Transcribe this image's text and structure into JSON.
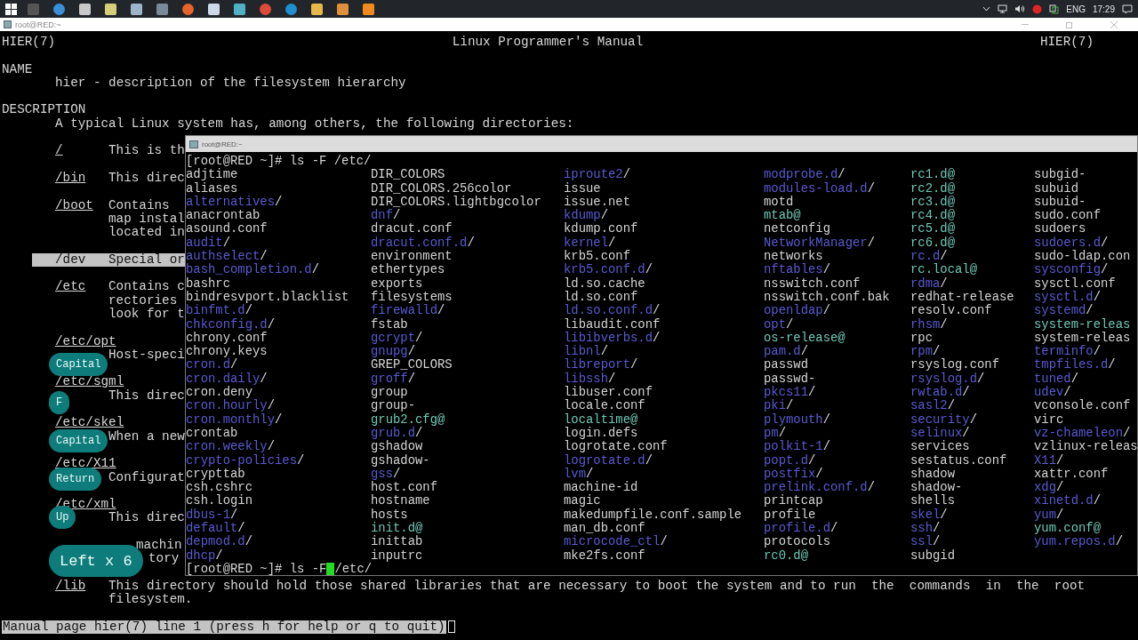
{
  "taskbar": {
    "tray": {
      "language": "ENG",
      "time": "17:29"
    }
  },
  "window": {
    "title": "root@RED:~"
  },
  "man_page": {
    "header_left": "HIER(7)",
    "header_center": "Linux Programmer's Manual",
    "header_right": "HIER(7)",
    "sections": [
      {
        "heading": "NAME",
        "paragraphs": [
          "hier - description of the filesystem hierarchy"
        ]
      },
      {
        "heading": "DESCRIPTION",
        "paragraphs": [
          "A typical Linux system has, among others, the following directories:"
        ],
        "entries": [
          {
            "kind": "inline",
            "tag": "/",
            "lines": [
              "This is th"
            ],
            "highlighted": false
          },
          {
            "kind": "inline",
            "tag": "/bin",
            "lines": [
              "This direc"
            ],
            "highlighted": false
          },
          {
            "kind": "inline",
            "tag": "/boot",
            "lines": [
              "Contains",
              "map instal",
              "located in"
            ],
            "highlighted": false
          },
          {
            "kind": "inline",
            "tag": "/dev",
            "lines": [
              "Special or"
            ],
            "highlighted": true
          },
          {
            "kind": "inline",
            "tag": "/etc",
            "lines": [
              "Contains c",
              "rectories",
              "look for t"
            ],
            "highlighted": false
          },
          {
            "kind": "hanging",
            "tag": "/etc/opt",
            "lines": [
              "Host-speci"
            ],
            "highlighted": false
          },
          {
            "kind": "hanging",
            "tag": "/etc/sgml",
            "lines": [
              "This direc"
            ],
            "highlighted": false
          },
          {
            "kind": "hanging",
            "tag": "/etc/skel",
            "lines": [
              "When a new"
            ],
            "highlighted": false
          },
          {
            "kind": "hanging",
            "tag": "/etc/X11",
            "lines": [
              "Configurat"
            ],
            "highlighted": false
          },
          {
            "kind": "hanging",
            "tag": "/etc/xml",
            "lines": [
              "This direc"
            ],
            "highlighted": false
          },
          {
            "kind": "covered",
            "lines": [
              "machin",
              "tory"
            ],
            "highlighted": false
          },
          {
            "kind": "inline",
            "tag": "/lib",
            "lines": [
              "This directory should hold those shared libraries that are necessary to boot the system and to run  the  commands  in  the  root",
              "filesystem."
            ],
            "highlighted": false
          }
        ]
      }
    ],
    "status_line": "Manual page hier(7) line 1 (press h for help or q to quit)"
  },
  "keypress_overlays": [
    {
      "label": "Capital"
    },
    {
      "label": "F"
    },
    {
      "label": "Capital"
    },
    {
      "label": "Return"
    },
    {
      "label": "Up"
    },
    {
      "label": "Left x 6"
    }
  ],
  "terminal": {
    "title": "root@RED:~",
    "command_line": "[root@RED ~]# ls -F /etc/",
    "columns": [
      [
        {
          "name": "adjtime",
          "kind": "file"
        },
        {
          "name": "aliases",
          "kind": "file"
        },
        {
          "name": "alternatives",
          "suffix": "/",
          "kind": "dir"
        },
        {
          "name": "anacrontab",
          "kind": "file"
        },
        {
          "name": "asound.conf",
          "kind": "file"
        },
        {
          "name": "audit",
          "suffix": "/",
          "kind": "dir"
        },
        {
          "name": "authselect",
          "suffix": "/",
          "kind": "dir"
        },
        {
          "name": "bash_completion.d",
          "suffix": "/",
          "kind": "dir"
        },
        {
          "name": "bashrc",
          "kind": "file"
        },
        {
          "name": "bindresvport.blacklist",
          "kind": "file"
        },
        {
          "name": "binfmt.d",
          "suffix": "/",
          "kind": "dir"
        },
        {
          "name": "chkconfig.d",
          "suffix": "/",
          "kind": "dir"
        },
        {
          "name": "chrony.conf",
          "kind": "file"
        },
        {
          "name": "chrony.keys",
          "kind": "file"
        },
        {
          "name": "cron.d",
          "suffix": "/",
          "kind": "dir"
        },
        {
          "name": "cron.daily",
          "suffix": "/",
          "kind": "dir"
        },
        {
          "name": "cron.deny",
          "kind": "file"
        },
        {
          "name": "cron.hourly",
          "suffix": "/",
          "kind": "dir"
        },
        {
          "name": "cron.monthly",
          "suffix": "/",
          "kind": "dir"
        },
        {
          "name": "crontab",
          "kind": "file"
        },
        {
          "name": "cron.weekly",
          "suffix": "/",
          "kind": "dir"
        },
        {
          "name": "crypto-policies",
          "suffix": "/",
          "kind": "dir"
        },
        {
          "name": "crypttab",
          "kind": "file"
        },
        {
          "name": "csh.cshrc",
          "kind": "file"
        },
        {
          "name": "csh.login",
          "kind": "file"
        },
        {
          "name": "dbus-1",
          "suffix": "/",
          "kind": "dir"
        },
        {
          "name": "default",
          "suffix": "/",
          "kind": "dir"
        },
        {
          "name": "depmod.d",
          "suffix": "/",
          "kind": "dir"
        },
        {
          "name": "dhcp",
          "suffix": "/",
          "kind": "dir"
        }
      ],
      [
        {
          "name": "DIR_COLORS",
          "kind": "file"
        },
        {
          "name": "DIR_COLORS.256color",
          "kind": "file"
        },
        {
          "name": "DIR_COLORS.lightbgcolor",
          "kind": "file"
        },
        {
          "name": "dnf",
          "suffix": "/",
          "kind": "dir"
        },
        {
          "name": "dracut.conf",
          "kind": "file"
        },
        {
          "name": "dracut.conf.d",
          "suffix": "/",
          "kind": "dir"
        },
        {
          "name": "environment",
          "kind": "file"
        },
        {
          "name": "ethertypes",
          "kind": "file"
        },
        {
          "name": "exports",
          "kind": "file"
        },
        {
          "name": "filesystems",
          "kind": "file"
        },
        {
          "name": "firewalld",
          "suffix": "/",
          "kind": "dir"
        },
        {
          "name": "fstab",
          "kind": "file"
        },
        {
          "name": "gcrypt",
          "suffix": "/",
          "kind": "dir"
        },
        {
          "name": "gnupg",
          "suffix": "/",
          "kind": "dir"
        },
        {
          "name": "GREP_COLORS",
          "kind": "file"
        },
        {
          "name": "groff",
          "suffix": "/",
          "kind": "dir"
        },
        {
          "name": "group",
          "kind": "file"
        },
        {
          "name": "group-",
          "kind": "file"
        },
        {
          "name": "grub2.cfg",
          "suffix": "@",
          "kind": "link"
        },
        {
          "name": "grub.d",
          "suffix": "/",
          "kind": "dir"
        },
        {
          "name": "gshadow",
          "kind": "file"
        },
        {
          "name": "gshadow-",
          "kind": "file"
        },
        {
          "name": "gss",
          "suffix": "/",
          "kind": "dir"
        },
        {
          "name": "host.conf",
          "kind": "file"
        },
        {
          "name": "hostname",
          "kind": "file"
        },
        {
          "name": "hosts",
          "kind": "file"
        },
        {
          "name": "init.d",
          "suffix": "@",
          "kind": "link"
        },
        {
          "name": "inittab",
          "kind": "file"
        },
        {
          "name": "inputrc",
          "kind": "file"
        }
      ],
      [
        {
          "name": "iproute2",
          "suffix": "/",
          "kind": "dir"
        },
        {
          "name": "issue",
          "kind": "file"
        },
        {
          "name": "issue.net",
          "kind": "file"
        },
        {
          "name": "kdump",
          "suffix": "/",
          "kind": "dir"
        },
        {
          "name": "kdump.conf",
          "kind": "file"
        },
        {
          "name": "kernel",
          "suffix": "/",
          "kind": "dir"
        },
        {
          "name": "krb5.conf",
          "kind": "file"
        },
        {
          "name": "krb5.conf.d",
          "suffix": "/",
          "kind": "dir"
        },
        {
          "name": "ld.so.cache",
          "kind": "file"
        },
        {
          "name": "ld.so.conf",
          "kind": "file"
        },
        {
          "name": "ld.so.conf.d",
          "suffix": "/",
          "kind": "dir"
        },
        {
          "name": "libaudit.conf",
          "kind": "file"
        },
        {
          "name": "libibverbs.d",
          "suffix": "/",
          "kind": "dir"
        },
        {
          "name": "libnl",
          "suffix": "/",
          "kind": "dir"
        },
        {
          "name": "libreport",
          "suffix": "/",
          "kind": "dir"
        },
        {
          "name": "libssh",
          "suffix": "/",
          "kind": "dir"
        },
        {
          "name": "libuser.conf",
          "kind": "file"
        },
        {
          "name": "locale.conf",
          "kind": "file"
        },
        {
          "name": "localtime",
          "suffix": "@",
          "kind": "link"
        },
        {
          "name": "login.defs",
          "kind": "file"
        },
        {
          "name": "logrotate.conf",
          "kind": "file"
        },
        {
          "name": "logrotate.d",
          "suffix": "/",
          "kind": "dir"
        },
        {
          "name": "lvm",
          "suffix": "/",
          "kind": "dir"
        },
        {
          "name": "machine-id",
          "kind": "file"
        },
        {
          "name": "magic",
          "kind": "file"
        },
        {
          "name": "makedumpfile.conf.sample",
          "kind": "file"
        },
        {
          "name": "man_db.conf",
          "kind": "file"
        },
        {
          "name": "microcode_ctl",
          "suffix": "/",
          "kind": "dir"
        },
        {
          "name": "mke2fs.conf",
          "kind": "file"
        }
      ],
      [
        {
          "name": "modprobe.d",
          "suffix": "/",
          "kind": "dir"
        },
        {
          "name": "modules-load.d",
          "suffix": "/",
          "kind": "dir"
        },
        {
          "name": "motd",
          "kind": "file"
        },
        {
          "name": "mtab",
          "suffix": "@",
          "kind": "link"
        },
        {
          "name": "netconfig",
          "kind": "file"
        },
        {
          "name": "NetworkManager",
          "suffix": "/",
          "kind": "dir"
        },
        {
          "name": "networks",
          "kind": "file"
        },
        {
          "name": "nftables",
          "suffix": "/",
          "kind": "dir"
        },
        {
          "name": "nsswitch.conf",
          "kind": "file"
        },
        {
          "name": "nsswitch.conf.bak",
          "kind": "file"
        },
        {
          "name": "openldap",
          "suffix": "/",
          "kind": "dir"
        },
        {
          "name": "opt",
          "suffix": "/",
          "kind": "dir"
        },
        {
          "name": "os-release",
          "suffix": "@",
          "kind": "link"
        },
        {
          "name": "pam.d",
          "suffix": "/",
          "kind": "dir"
        },
        {
          "name": "passwd",
          "kind": "file"
        },
        {
          "name": "passwd-",
          "kind": "file"
        },
        {
          "name": "pkcs11",
          "suffix": "/",
          "kind": "dir"
        },
        {
          "name": "pki",
          "suffix": "/",
          "kind": "dir"
        },
        {
          "name": "plymouth",
          "suffix": "/",
          "kind": "dir"
        },
        {
          "name": "pm",
          "suffix": "/",
          "kind": "dir"
        },
        {
          "name": "polkit-1",
          "suffix": "/",
          "kind": "dir"
        },
        {
          "name": "popt.d",
          "suffix": "/",
          "kind": "dir"
        },
        {
          "name": "postfix",
          "suffix": "/",
          "kind": "dir"
        },
        {
          "name": "prelink.conf.d",
          "suffix": "/",
          "kind": "dir"
        },
        {
          "name": "printcap",
          "kind": "file"
        },
        {
          "name": "profile",
          "kind": "file"
        },
        {
          "name": "profile.d",
          "suffix": "/",
          "kind": "dir"
        },
        {
          "name": "protocols",
          "kind": "file"
        },
        {
          "name": "rc0.d",
          "suffix": "@",
          "kind": "link"
        }
      ],
      [
        {
          "name": "rc1.d",
          "suffix": "@",
          "kind": "link"
        },
        {
          "name": "rc2.d",
          "suffix": "@",
          "kind": "link"
        },
        {
          "name": "rc3.d",
          "suffix": "@",
          "kind": "link"
        },
        {
          "name": "rc4.d",
          "suffix": "@",
          "kind": "link"
        },
        {
          "name": "rc5.d",
          "suffix": "@",
          "kind": "link"
        },
        {
          "name": "rc6.d",
          "suffix": "@",
          "kind": "link"
        },
        {
          "name": "rc.d",
          "suffix": "/",
          "kind": "dir"
        },
        {
          "name": "rc.local",
          "suffix": "@",
          "kind": "link"
        },
        {
          "name": "rdma",
          "suffix": "/",
          "kind": "dir"
        },
        {
          "name": "redhat-release",
          "kind": "file"
        },
        {
          "name": "resolv.conf",
          "kind": "file"
        },
        {
          "name": "rhsm",
          "suffix": "/",
          "kind": "dir"
        },
        {
          "name": "rpc",
          "kind": "file"
        },
        {
          "name": "rpm",
          "suffix": "/",
          "kind": "dir"
        },
        {
          "name": "rsyslog.conf",
          "kind": "file"
        },
        {
          "name": "rsyslog.d",
          "suffix": "/",
          "kind": "dir"
        },
        {
          "name": "rwtab.d",
          "suffix": "/",
          "kind": "dir"
        },
        {
          "name": "sasl2",
          "suffix": "/",
          "kind": "dir"
        },
        {
          "name": "security",
          "suffix": "/",
          "kind": "dir"
        },
        {
          "name": "selinux",
          "suffix": "/",
          "kind": "dir"
        },
        {
          "name": "services",
          "kind": "file"
        },
        {
          "name": "sestatus.conf",
          "kind": "file"
        },
        {
          "name": "shadow",
          "kind": "file"
        },
        {
          "name": "shadow-",
          "kind": "file"
        },
        {
          "name": "shells",
          "kind": "file"
        },
        {
          "name": "skel",
          "suffix": "/",
          "kind": "dir"
        },
        {
          "name": "ssh",
          "suffix": "/",
          "kind": "dir"
        },
        {
          "name": "ssl",
          "suffix": "/",
          "kind": "dir"
        },
        {
          "name": "subgid",
          "kind": "file"
        }
      ],
      [
        {
          "name": "subgid-",
          "kind": "file"
        },
        {
          "name": "subuid",
          "kind": "file"
        },
        {
          "name": "subuid-",
          "kind": "file"
        },
        {
          "name": "sudo.conf",
          "kind": "file"
        },
        {
          "name": "sudoers",
          "kind": "file"
        },
        {
          "name": "sudoers.d",
          "suffix": "/",
          "kind": "dir"
        },
        {
          "name": "sudo-ldap.con",
          "kind": "file"
        },
        {
          "name": "sysconfig",
          "suffix": "/",
          "kind": "dir"
        },
        {
          "name": "sysctl.conf",
          "kind": "file"
        },
        {
          "name": "sysctl.d",
          "suffix": "/",
          "kind": "dir"
        },
        {
          "name": "systemd",
          "suffix": "/",
          "kind": "dir"
        },
        {
          "name": "system-releas",
          "kind": "link"
        },
        {
          "name": "system-releas",
          "kind": "file"
        },
        {
          "name": "terminfo",
          "suffix": "/",
          "kind": "dir"
        },
        {
          "name": "tmpfiles.d",
          "suffix": "/",
          "kind": "dir"
        },
        {
          "name": "tuned",
          "suffix": "/",
          "kind": "dir"
        },
        {
          "name": "udev",
          "suffix": "/",
          "kind": "dir"
        },
        {
          "name": "vconsole.conf",
          "kind": "file"
        },
        {
          "name": "virc",
          "kind": "file"
        },
        {
          "name": "vz-chameleon",
          "suffix": "/",
          "kind": "dir"
        },
        {
          "name": "vzlinux-releas",
          "kind": "file"
        },
        {
          "name": "X11",
          "suffix": "/",
          "kind": "dir"
        },
        {
          "name": "xattr.conf",
          "kind": "file"
        },
        {
          "name": "xdg",
          "suffix": "/",
          "kind": "dir"
        },
        {
          "name": "xinetd.d",
          "suffix": "/",
          "kind": "dir"
        },
        {
          "name": "yum",
          "suffix": "/",
          "kind": "dir"
        },
        {
          "name": "yum.conf",
          "suffix": "@",
          "kind": "link"
        },
        {
          "name": "yum.repos.d",
          "suffix": "/",
          "kind": "dir"
        }
      ]
    ],
    "input_line": {
      "before_cursor": "[root@RED ~]# ls -F",
      "after_cursor": "/etc/",
      "cursor": true
    }
  }
}
